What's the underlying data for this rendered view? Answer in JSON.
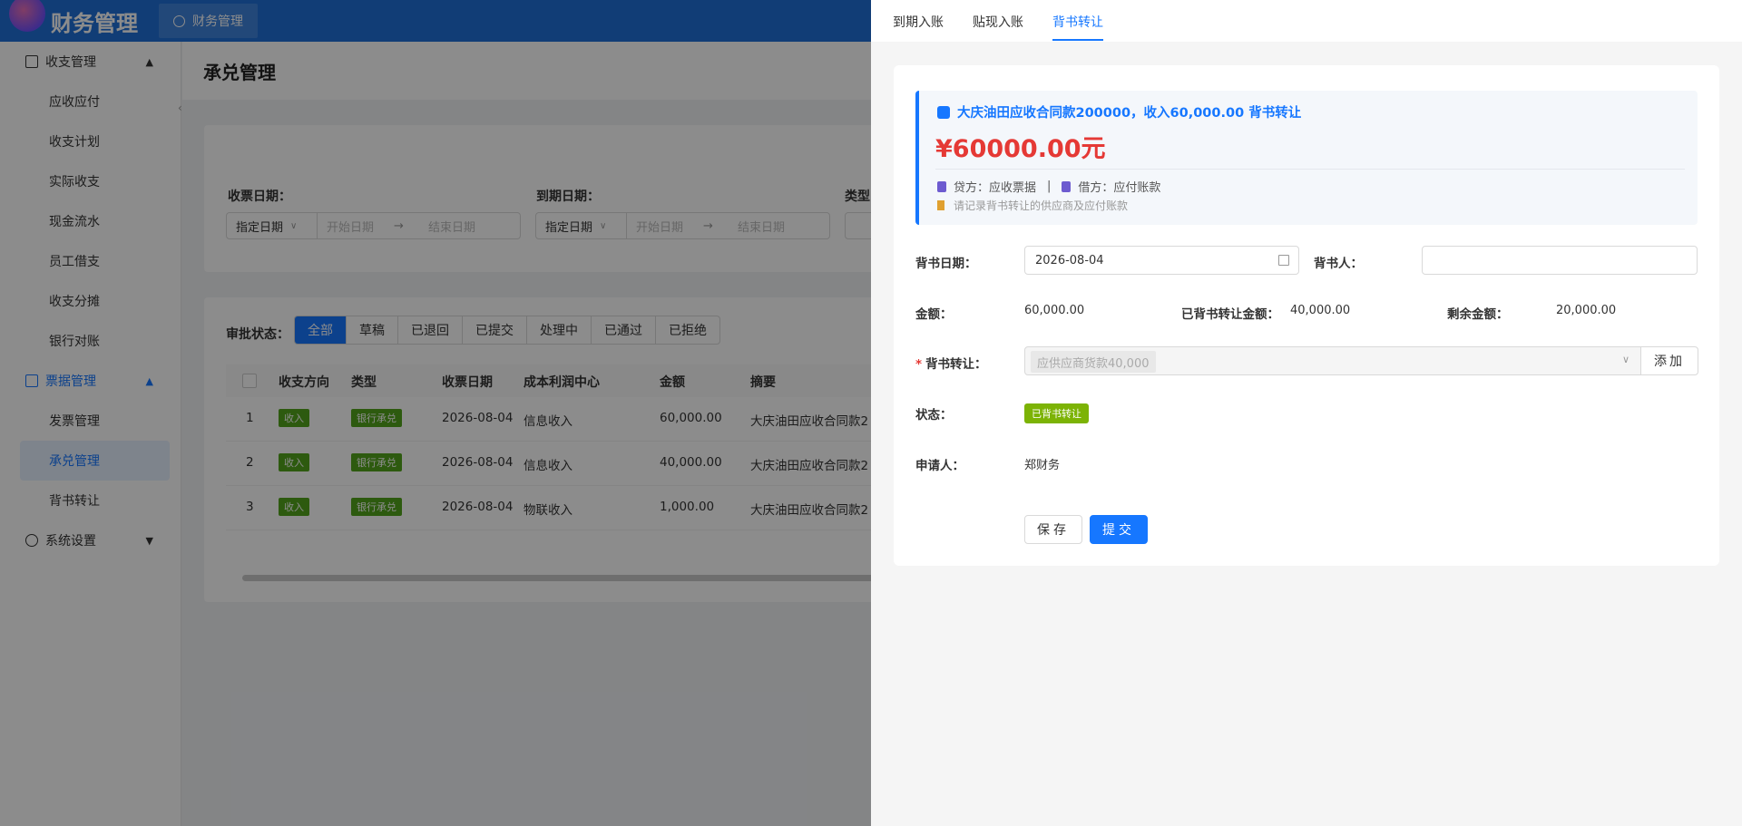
{
  "app": {
    "title": "财务管理",
    "tab_label": "财务管理"
  },
  "sidebar": {
    "groups": [
      {
        "label": "收支管理",
        "items": [
          "应收应付",
          "收支计划",
          "实际收支",
          "现金流水",
          "员工借支",
          "收支分摊",
          "银行对账"
        ]
      },
      {
        "label": "票据管理",
        "items": [
          "发票管理",
          "承兑管理",
          "背书转让"
        ]
      },
      {
        "label": "系统设置"
      }
    ],
    "active_item": "承兑管理"
  },
  "main": {
    "page_title": "承兑管理",
    "filters": {
      "receipt_date_label": "收票日期：",
      "due_date_label": "到期日期：",
      "type_label": "类型",
      "select_value": "指定日期",
      "start_placeholder": "开始日期",
      "end_placeholder": "结束日期"
    },
    "status_filter": {
      "label": "审批状态：",
      "options": [
        "全部",
        "草稿",
        "已退回",
        "已提交",
        "处理中",
        "已通过",
        "已拒绝"
      ],
      "selected": "全部"
    },
    "table": {
      "columns": [
        "收支方向",
        "类型",
        "收票日期",
        "成本利润中心",
        "金额",
        "摘要"
      ],
      "rows": [
        {
          "index": "1",
          "direction": "收入",
          "type": "银行承兑",
          "date": "2026-08-04",
          "center": "信息收入",
          "amount": "60,000.00",
          "summary": "大庆油田应收合同款2"
        },
        {
          "index": "2",
          "direction": "收入",
          "type": "银行承兑",
          "date": "2026-08-04",
          "center": "信息收入",
          "amount": "40,000.00",
          "summary": "大庆油田应收合同款2"
        },
        {
          "index": "3",
          "direction": "收入",
          "type": "银行承兑",
          "date": "2026-08-04",
          "center": "物联收入",
          "amount": "1,000.00",
          "summary": "大庆油田应收合同款2"
        }
      ]
    }
  },
  "drawer": {
    "tabs": [
      "到期入账",
      "贴现入账",
      "背书转让"
    ],
    "active_tab": "背书转让",
    "info": {
      "title": "大庆油田应收合同款200000，收入60,000.00 背书转让",
      "amount": "¥60000.00元",
      "credit": "贷方：应收票据",
      "separator": "|",
      "debit": "借方：应付账款",
      "hint": "请记录背书转让的供应商及应付账款"
    },
    "form": {
      "endorse_date_label": "背书日期：",
      "endorse_date_value": "2026-08-04",
      "endorser_label": "背书人：",
      "endorser_value": "",
      "amount_label": "金额：",
      "amount_value": "60,000.00",
      "transferred_label": "已背书转让金额：",
      "transferred_value": "40,000.00",
      "remaining_label": "剩余金额：",
      "remaining_value": "20,000.00",
      "transfer_label": "背书转让：",
      "transfer_chip": "应供应商货款40,000",
      "add_button": "添加",
      "status_label": "状态：",
      "status_value": "已背书转让",
      "applicant_label": "申请人：",
      "applicant_value": "郑财务",
      "save_button": "保存",
      "submit_button": "提交"
    }
  },
  "colors": {
    "brand": "#1f6fd8",
    "primary": "#1677ff",
    "danger": "#e53935",
    "success_tag": "#52a51c",
    "status_tag": "#7cb305"
  }
}
